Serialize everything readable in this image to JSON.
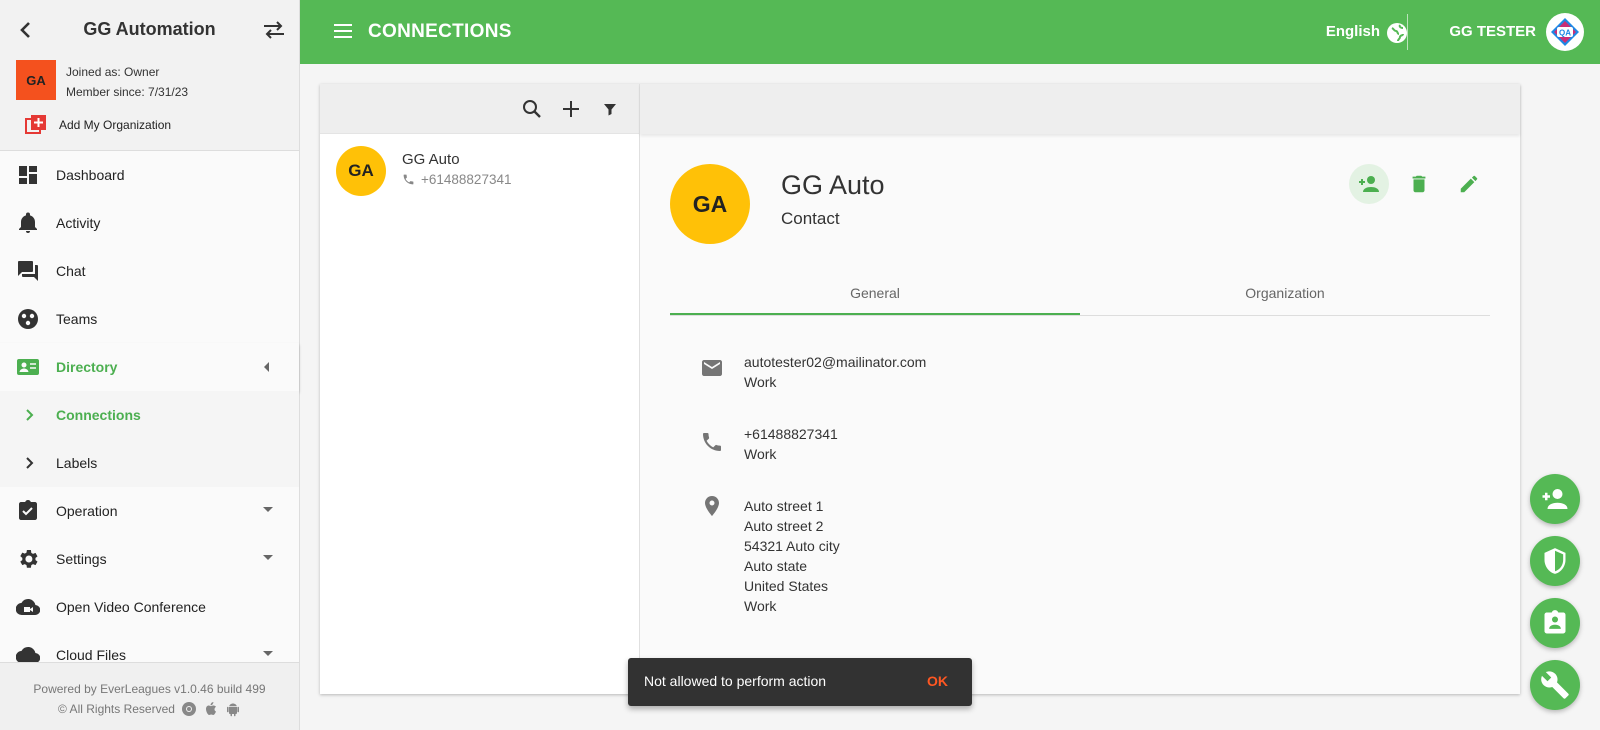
{
  "sidebar": {
    "org_name": "GG Automation",
    "avatar_initials": "GA",
    "joined_as": "Joined as: Owner",
    "member_since": "Member since: 7/31/23",
    "add_org_label": "Add My Organization",
    "items": [
      {
        "label": "Dashboard",
        "icon": "dashboard-icon"
      },
      {
        "label": "Activity",
        "icon": "bell-icon"
      },
      {
        "label": "Chat",
        "icon": "chat-icon"
      },
      {
        "label": "Teams",
        "icon": "teams-icon"
      },
      {
        "label": "Directory",
        "icon": "contact-card-icon"
      },
      {
        "label": "Connections",
        "icon": "chevron-right-icon"
      },
      {
        "label": "Labels",
        "icon": "chevron-right-icon"
      },
      {
        "label": "Operation",
        "icon": "clipboard-check-icon"
      },
      {
        "label": "Settings",
        "icon": "gear-icon"
      },
      {
        "label": "Open Video Conference",
        "icon": "cloud-video-icon"
      },
      {
        "label": "Cloud Files",
        "icon": "cloud-icon"
      }
    ],
    "footer_line1": "Powered by EverLeagues v1.0.46 build 499",
    "footer_line2": "© All Rights Reserved"
  },
  "header": {
    "title": "CONNECTIONS",
    "language": "English",
    "user_name": "GG TESTER",
    "logo_text": "QA"
  },
  "contacts": [
    {
      "initials": "GA",
      "name": "GG Auto",
      "phone": "+61488827341"
    }
  ],
  "detail": {
    "initials": "GA",
    "name": "GG Auto",
    "type": "Contact",
    "tabs": [
      "General",
      "Organization"
    ],
    "email": {
      "value": "autotester02@mailinator.com",
      "label": "Work"
    },
    "phone": {
      "value": "+61488827341",
      "label": "Work"
    },
    "address": {
      "line1": "Auto street 1",
      "line2": "Auto street 2",
      "line3": "54321 Auto city",
      "line4": "Auto state",
      "line5": "United States",
      "label": "Work"
    }
  },
  "snackbar": {
    "message": "Not allowed to perform action",
    "action": "OK"
  },
  "colors": {
    "primary_green": "#55b955",
    "avatar_yellow": "#ffc107",
    "org_avatar_orange": "#f4511e",
    "snackbar_action": "#ff5722"
  }
}
